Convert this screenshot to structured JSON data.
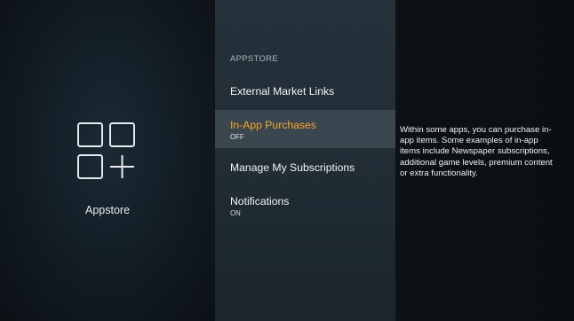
{
  "app": {
    "icon": "app-grid-plus-icon",
    "name": "Appstore"
  },
  "menu": {
    "header": "APPSTORE",
    "items": [
      {
        "label": "External Market Links",
        "sub": ""
      },
      {
        "label": "In-App Purchases",
        "sub": "OFF"
      },
      {
        "label": "Manage My Subscriptions",
        "sub": ""
      },
      {
        "label": "Notifications",
        "sub": "ON"
      }
    ],
    "selected_index": 1
  },
  "description": {
    "text": "Within some apps, you can purchase in-app items. Some examples of in-app items include Newspaper subscriptions, additional game levels, premium content or extra functionality."
  },
  "colors": {
    "accent": "#f0a52c",
    "selected_bg": "#3b474f",
    "text": "#f2f4f6"
  }
}
